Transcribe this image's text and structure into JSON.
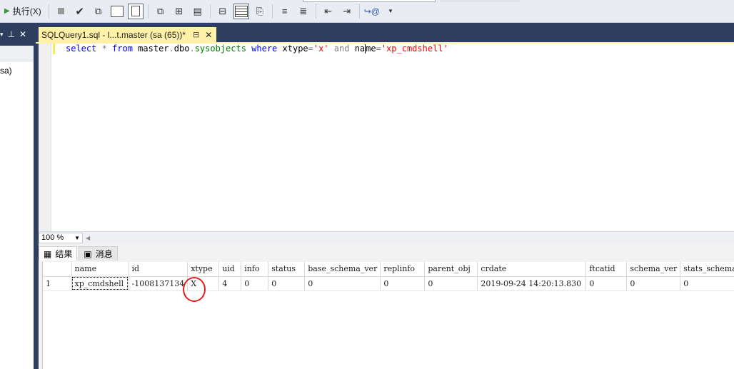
{
  "toolbar": {
    "execute_label": "执行(X)",
    "icons": [
      "execute-icon",
      "stop-icon",
      "parse-icon",
      "display-plan-icon",
      "query-designer-icon",
      "results-to-text-icon",
      "results-to-grid-icon",
      "results-to-file-icon",
      "comment-icon",
      "uncomment-icon",
      "decrease-indent-icon",
      "increase-indent-icon",
      "specify-values-icon"
    ]
  },
  "object_explorer": {
    "pin_label": "ꟷ",
    "autohide_label": "⊟",
    "close_label": "✕",
    "item_text": "sa)"
  },
  "document_tab": {
    "title": "SQLQuery1.sql - l...t.master (sa (65))*",
    "pin": "⊟",
    "close": "✕"
  },
  "editor": {
    "tokens": [
      {
        "t": "select",
        "c": "kw"
      },
      {
        "t": " * ",
        "c": "op"
      },
      {
        "t": "from",
        "c": "kw"
      },
      {
        "t": " master",
        "c": "id"
      },
      {
        "t": ".",
        "c": "op"
      },
      {
        "t": "dbo",
        "c": "id"
      },
      {
        "t": ".",
        "c": "op"
      },
      {
        "t": "sysobjects",
        "c": "sys"
      },
      {
        "t": " where ",
        "c": "kw"
      },
      {
        "t": "xtype",
        "c": "id"
      },
      {
        "t": "=",
        "c": "op"
      },
      {
        "t": "'x'",
        "c": "str"
      },
      {
        "t": " and ",
        "c": "op"
      },
      {
        "t": "na",
        "c": "id"
      },
      {
        "t": "me",
        "c": "id"
      },
      {
        "t": "=",
        "c": "op"
      },
      {
        "t": "'xp_cmdshell'",
        "c": "str"
      }
    ]
  },
  "zoom": {
    "value": "100 %"
  },
  "results": {
    "tabs": [
      "结果",
      "消息"
    ],
    "columns": [
      "",
      "name",
      "id",
      "xtype",
      "uid",
      "info",
      "status",
      "base_schema_ver",
      "replinfo",
      "parent_obj",
      "crdate",
      "ftcatid",
      "schema_ver",
      "stats_schema_"
    ],
    "rows": [
      [
        "1",
        "xp_cmdshell",
        "-1008137134",
        "X",
        "4",
        "0",
        "0",
        "0",
        "0",
        "0",
        "2019-09-24 14:20:13.830",
        "0",
        "0",
        "0"
      ]
    ]
  },
  "colors": {
    "chrome": "#2d3e5e",
    "active_tab": "#fff1a8",
    "keyword": "#0000ff",
    "string": "#ff0000",
    "system_object": "#008000",
    "annotation": "#e02020"
  }
}
